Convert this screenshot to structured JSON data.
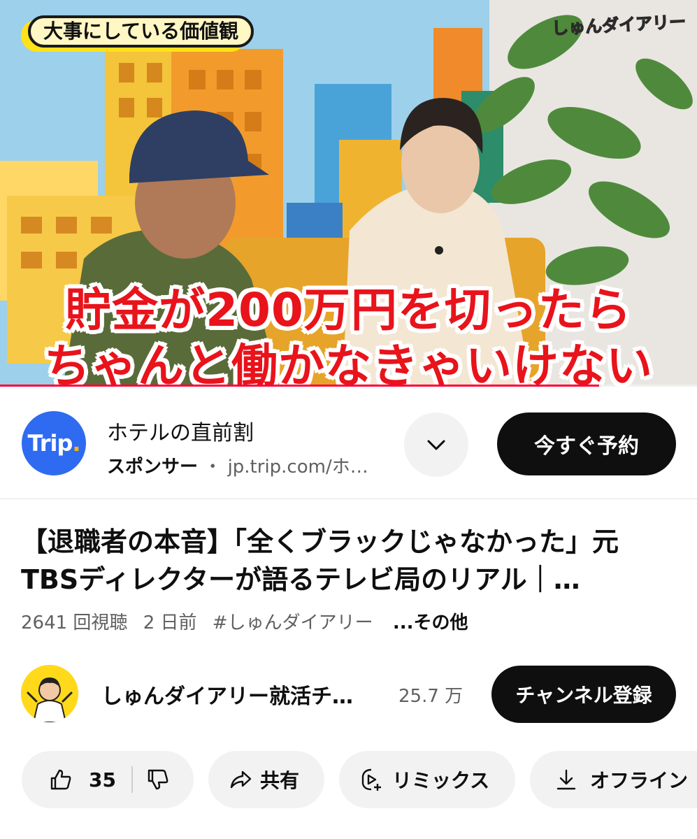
{
  "video": {
    "topic_tag": "大事にしている価値観",
    "channel_logo": "しゅんダイアリー",
    "caption_line1": "貯金が200万円を切ったら",
    "caption_line2": "ちゃんと働かなきゃいけない",
    "progress_fraction": 0.86,
    "progress_color": "#ff0033"
  },
  "ad": {
    "logo_text": "Trip",
    "logo_dot": ".",
    "title": "ホテルの直前割",
    "sponsor_label": "スポンサー",
    "separator": "・",
    "url": "jp.trip.com/ホ…",
    "expand_icon": "chevron-down-icon",
    "cta_label": "今すぐ予約",
    "logo_color": "#2f6bf0"
  },
  "title": {
    "line1": "【退職者の本音】「全くブラックじゃなかった」元",
    "line2": "TBSディレクターが語るテレビ局のリアル｜…"
  },
  "meta": {
    "views": "2641 回視聴",
    "age": "2 日前",
    "hashtag": "#しゅんダイアリー",
    "more": "...その他"
  },
  "channel": {
    "name": "しゅんダイアリー就活チ…",
    "subscribers": "25.7 万",
    "subscribe_label": "チャンネル登録"
  },
  "actions": {
    "like_count": "35",
    "share_label": "共有",
    "remix_label": "リミックス",
    "offline_label": "オフライン"
  }
}
